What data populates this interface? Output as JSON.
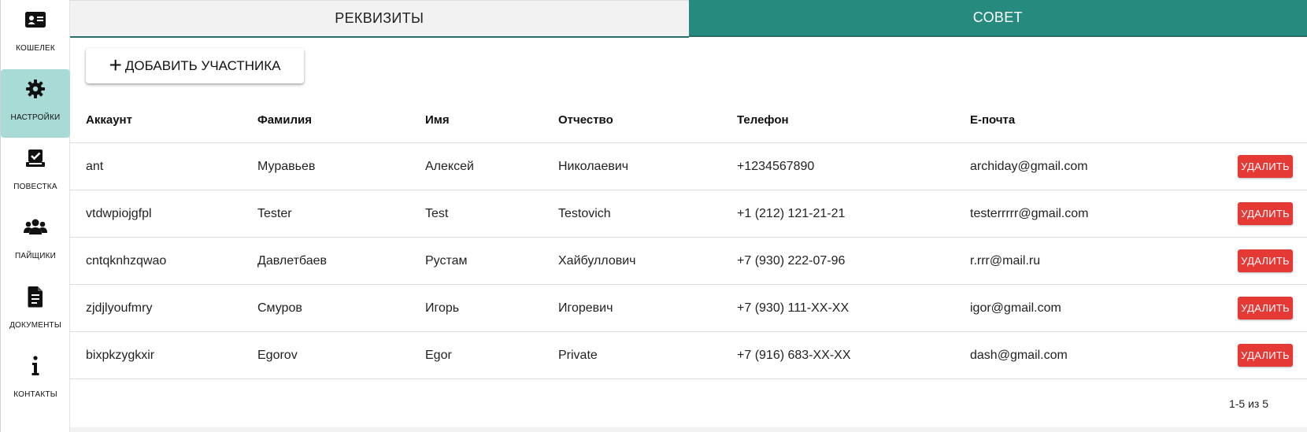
{
  "sidebar": {
    "items": [
      {
        "label": "КОШЕЛЕК",
        "icon": "wallet-card-icon"
      },
      {
        "label": "НАСТРОЙКИ",
        "icon": "gear-icon",
        "active": true
      },
      {
        "label": "ПОВЕСТКА",
        "icon": "agenda-check-icon"
      },
      {
        "label": "ПАЙЩИКИ",
        "icon": "users-icon"
      },
      {
        "label": "ДОКУМЕНТЫ",
        "icon": "document-icon"
      },
      {
        "label": "КОНТАКТЫ",
        "icon": "info-icon"
      }
    ]
  },
  "tabs": [
    {
      "label": "РЕКВИЗИТЫ",
      "active": false
    },
    {
      "label": "СОВЕТ",
      "active": true
    }
  ],
  "toolbar": {
    "add_label": "ДОБАВИТЬ УЧАСТНИКА"
  },
  "table": {
    "headers": [
      "Аккаунт",
      "Фамилия",
      "Имя",
      "Отчество",
      "Телефон",
      "E-почта"
    ],
    "rows": [
      [
        "ant",
        "Муравьев",
        "Алексей",
        "Николаевич",
        "+1234567890",
        "archiday@gmail.com"
      ],
      [
        "vtdwpiojgfpl",
        "Tester",
        "Test",
        "Testovich",
        "+1 (212) 121-21-21",
        "testerrrrr@gmail.com"
      ],
      [
        "cntqknhzqwao",
        "Давлетбаев",
        "Рустам",
        "Хайбуллович",
        "+7 (930) 222-07-96",
        "r.rrr@mail.ru"
      ],
      [
        "zjdjlyoufmry",
        "Смуров",
        "Игорь",
        "Игоревич",
        "+7 (930) 111-XX-XX",
        "igor@gmail.com"
      ],
      [
        "bixpkzygkxir",
        "Egorov",
        "Egor",
        "Private",
        "+7 (916) 683-XX-XX",
        "dash@gmail.com"
      ]
    ],
    "delete_label": "УДАЛИТЬ"
  },
  "pagination": {
    "text": "1-5 из 5"
  },
  "colors": {
    "accent": "#268a7e",
    "active_nav": "#a9dbd6",
    "danger": "#e53935"
  }
}
